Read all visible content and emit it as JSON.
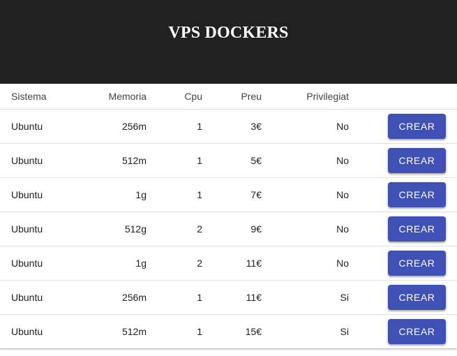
{
  "header": {
    "title": "VPS DOCKERS"
  },
  "table": {
    "columns": {
      "sistema": "Sistema",
      "memoria": "Memoria",
      "cpu": "Cpu",
      "preu": "Preu",
      "privilegiat": "Privilegiat"
    },
    "rows": [
      {
        "sistema": "Ubuntu",
        "memoria": "256m",
        "cpu": "1",
        "preu": "3€",
        "privilegiat": "No",
        "action": "CREAR"
      },
      {
        "sistema": "Ubuntu",
        "memoria": "512m",
        "cpu": "1",
        "preu": "5€",
        "privilegiat": "No",
        "action": "CREAR"
      },
      {
        "sistema": "Ubuntu",
        "memoria": "1g",
        "cpu": "1",
        "preu": "7€",
        "privilegiat": "No",
        "action": "CREAR"
      },
      {
        "sistema": "Ubuntu",
        "memoria": "512g",
        "cpu": "2",
        "preu": "9€",
        "privilegiat": "No",
        "action": "CREAR"
      },
      {
        "sistema": "Ubuntu",
        "memoria": "1g",
        "cpu": "2",
        "preu": "11€",
        "privilegiat": "No",
        "action": "CREAR"
      },
      {
        "sistema": "Ubuntu",
        "memoria": "256m",
        "cpu": "1",
        "preu": "11€",
        "privilegiat": "Si",
        "action": "CREAR"
      },
      {
        "sistema": "Ubuntu",
        "memoria": "512m",
        "cpu": "1",
        "preu": "15€",
        "privilegiat": "Si",
        "action": "CREAR"
      }
    ]
  },
  "colors": {
    "header_bg": "#212121",
    "header_text": "#ffffff",
    "button_bg": "#3f51b5",
    "button_text": "#ffffff"
  }
}
